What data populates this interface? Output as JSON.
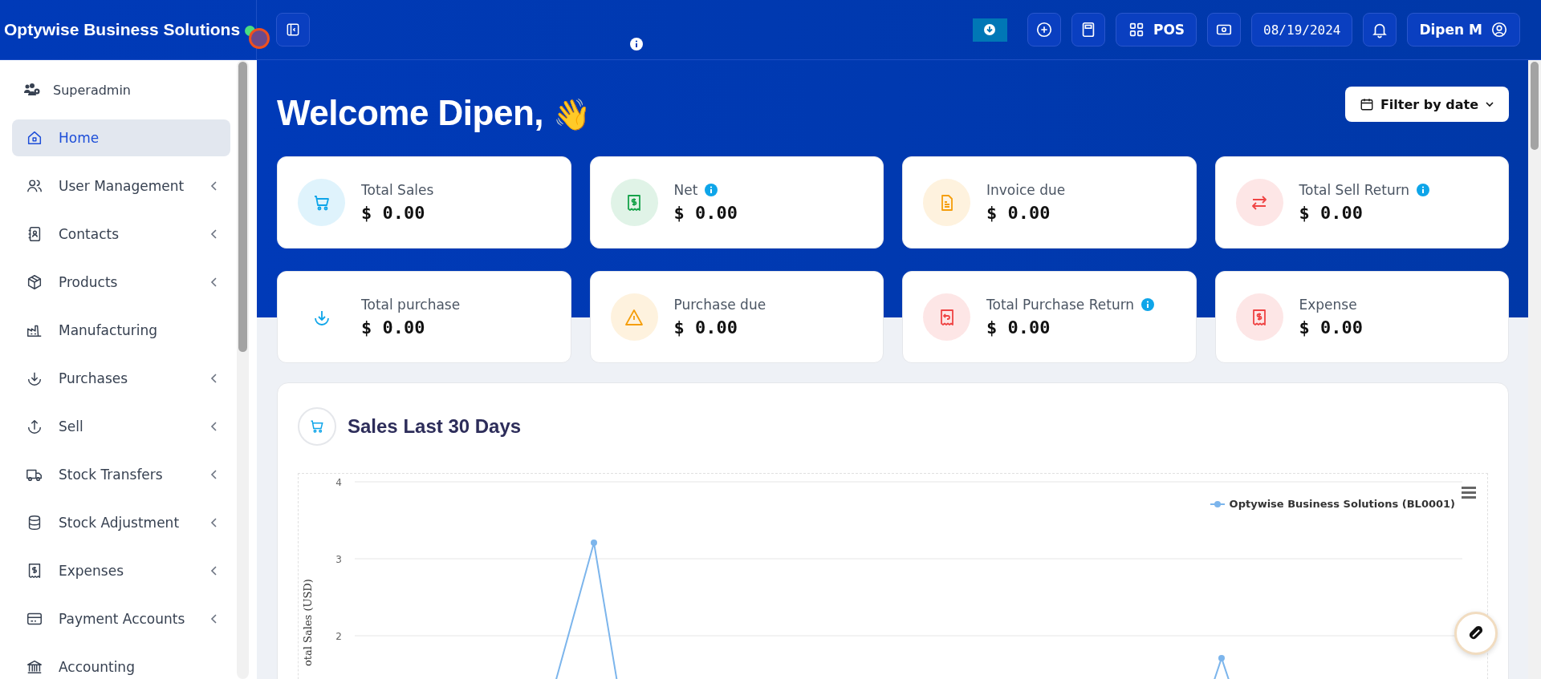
{
  "brand": {
    "title": "Optywise Business Solutions",
    "online": true
  },
  "topbar": {
    "buttons": [
      {
        "kind": "download"
      },
      {
        "kind": "add"
      },
      {
        "kind": "calculator"
      },
      {
        "kind": "pos",
        "label": "POS"
      },
      {
        "kind": "cash"
      },
      {
        "kind": "date",
        "label": "08/19/2024"
      },
      {
        "kind": "bell"
      },
      {
        "kind": "user",
        "label": "Dipen M"
      }
    ]
  },
  "sidebar": {
    "role": "Superadmin",
    "items": [
      {
        "label": "Home",
        "kind": "home",
        "selected": true,
        "expandable": false
      },
      {
        "label": "User Management",
        "kind": "users",
        "selected": false,
        "expandable": true
      },
      {
        "label": "Contacts",
        "kind": "contacts",
        "selected": false,
        "expandable": true
      },
      {
        "label": "Products",
        "kind": "box",
        "selected": false,
        "expandable": true
      },
      {
        "label": "Manufacturing",
        "kind": "factory",
        "selected": false,
        "expandable": false
      },
      {
        "label": "Purchases",
        "kind": "down",
        "selected": false,
        "expandable": true
      },
      {
        "label": "Sell",
        "kind": "up",
        "selected": false,
        "expandable": true
      },
      {
        "label": "Stock Transfers",
        "kind": "truck",
        "selected": false,
        "expandable": true
      },
      {
        "label": "Stock Adjustment",
        "kind": "database",
        "selected": false,
        "expandable": true
      },
      {
        "label": "Expenses",
        "kind": "receipt",
        "selected": false,
        "expandable": true
      },
      {
        "label": "Payment Accounts",
        "kind": "card",
        "selected": false,
        "expandable": true
      },
      {
        "label": "Accounting",
        "kind": "bank",
        "selected": false,
        "expandable": false
      }
    ]
  },
  "welcome": {
    "title": "Welcome Dipen,",
    "emoji": "👋",
    "filter_label": "Filter by date"
  },
  "stats": [
    {
      "label": "Total Sales",
      "value": "$ 0.00",
      "kind": "cart",
      "color": "#0ea5e9",
      "info": false
    },
    {
      "label": "Net",
      "value": "$ 0.00",
      "kind": "receipt",
      "color": "#16a34a",
      "info": true
    },
    {
      "label": "Invoice due",
      "value": "$ 0.00",
      "kind": "file",
      "color": "#f59e0b",
      "info": false
    },
    {
      "label": "Total Sell Return",
      "value": "$ 0.00",
      "kind": "swap",
      "color": "#ef4444",
      "info": true
    },
    {
      "label": "Total purchase",
      "value": "$ 0.00",
      "kind": "down",
      "color": "#0ea5e9",
      "info": false
    },
    {
      "label": "Purchase due",
      "value": "$ 0.00",
      "kind": "warning",
      "color": "#f59e0b",
      "info": false
    },
    {
      "label": "Total Purchase Return",
      "value": "$ 0.00",
      "kind": "return",
      "color": "#ef4444",
      "info": true
    },
    {
      "label": "Expense",
      "value": "$ 0.00",
      "kind": "receipt",
      "color": "#ef4444",
      "info": false
    }
  ],
  "sales_chart": {
    "title": "Sales Last 30 Days",
    "y_axis_label": "otal Sales (USD)",
    "y_ticks": [
      "4",
      "3",
      "2"
    ],
    "legend": "Optywise Business Solutions (BL0001)"
  }
}
